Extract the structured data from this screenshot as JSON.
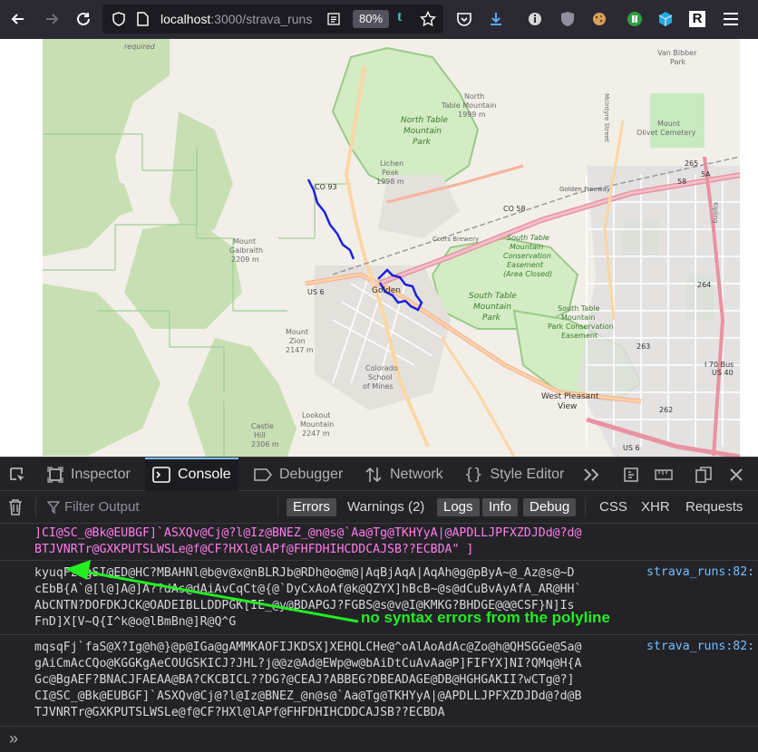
{
  "browser": {
    "url_host": "localhost",
    "url_path": ":3000/strava_runs",
    "zoom": "80%"
  },
  "map": {
    "labels": {
      "required": "required",
      "van_bibber": "Van Bibber",
      "park": "Park",
      "north_table_mountain": "North",
      "north_table_mountain2": "Table Mountain",
      "north_elev": "1999 m",
      "ntm_park1": "North Table",
      "ntm_park2": "Mountain",
      "ntm_park3": "Park",
      "mount_olivet1": "Mount",
      "mount_olivet2": "Olivet Cemetery",
      "lichen1": "Lichen",
      "lichen2": "Peak",
      "lichen3": "1998 m",
      "co93": "CO 93",
      "co58": "CO 58",
      "golden_fwy": "Golden Freeway",
      "coors": "Coors Brewery",
      "galbraith1": "Mount",
      "galbraith2": "Galbraith",
      "galbraith3": "2209 m",
      "stm1": "South Table",
      "stm2": "Mountain",
      "stm3": "Conservation",
      "stm4": "Easement",
      "stm5": "(Area Closed)",
      "stm_park1": "South Table",
      "stm_park2": "Mountain",
      "stm_park3": "Park",
      "stm_cons1": "South Table",
      "stm_cons2": "Mountain",
      "stm_cons3": "Park Conservation",
      "stm_cons4": "Easement",
      "golden": "Golden",
      "us6": "US 6",
      "us6b": "US 6",
      "zion1": "Mount",
      "zion2": "Zion",
      "zion3": "2147 m",
      "mines1": "Colorado",
      "mines2": "School",
      "mines3": "of Mines",
      "wpv1": "West Pleasant",
      "wpv2": "View",
      "lookout1": "Lookout",
      "lookout2": "Mountain",
      "lookout3": "2247 m",
      "castle1": "Castle",
      "castle2": "Hill",
      "castle3": "2306 m",
      "i70a": "I 70 Bus",
      "i70b": "US 40",
      "r265": "265",
      "r264": "264",
      "r263": "263",
      "r262": "262",
      "r58": "58",
      "r5a": "5A",
      "mcintyre": "McIntyre Street",
      "kipling": "Kipling"
    }
  },
  "devtools": {
    "tabs": {
      "inspector": "Inspector",
      "console": "Console",
      "debugger": "Debugger",
      "network": "Network",
      "style_editor": "Style Editor"
    },
    "filter_placeholder": "Filter Output",
    "filters": {
      "errors": "Errors",
      "warnings": "Warnings (2)",
      "logs": "Logs",
      "info": "Info",
      "debug": "Debug",
      "css": "CSS",
      "xhr": "XHR",
      "requests": "Requests"
    },
    "messages": [
      {
        "lines": [
          "]CI@SC_@Bk@EUBGF]`ASXQv@Cj@?l@Iz@BNEZ_@n@s@`Aa@Tg@TKHYyA|@APDLLJPFXZDJDd@?d@",
          "BTJVNRTr@GXKPUTSLWSLe@f@CF?HXl@lAPf@FHFDHIHCDDCAJSB??ECBDA\" ]"
        ],
        "source": ""
      },
      {
        "lines": [
          "kyuqFzsgSI@ED@HC?MBAHNl@b@v@x@nBLRJb@RDh@o@m@|AqBjAqA|AqAh@g@pByA~@_Az@s@~D",
          "cEbB{A`@[l@]A@]A??dAs@dAiAvCqCt@{@`DyCxAoAf@k@QZYX]hBcB~@s@dCuBvAyAfA_AR@HH`",
          "AbCNTN?DOFDKJCK@OADEIBLLDDPGK[IE_@y@BDAPGJ?FGBS@s@v@I@KMKG?BHDGE@@@CSF}N]Is",
          "FnD]X[V~Q{I^k@o@lBmBn@]R@Q^G"
        ],
        "source": "strava_runs:82:"
      },
      {
        "lines": [
          "mqsqFj`faS@X?Ig@h@}@p@IGa@gAMMKAOFIJKDSX]XEHQLCHe@^oAlAoAdAc@Zo@h@QHSGGe@Sa@",
          "gAiCmAcCQo@KGGKgAeCOUGSKICJ?JHL?j@@z@Ad@EWp@w@bAiDtCuAvAa@P]FIFYX]NI?QMq@H{A",
          "Gc@BgAEF?BNACJFAEAA@BA?CKCBICL??DG?@CEAJ?ABBEG?DBEADAGE@DB@HGHGAKII?wCTg@?]",
          "CI@SC_@Bk@EUBGF]`ASXQv@Cj@?l@Iz@BNEZ_@n@s@`Aa@Tg@TKHYyA|@APDLLJPFXZDJDd@?d@B",
          "TJVNRTr@GXKPUTSLWSLe@f@CF?HXl@lAPf@FHFDHIHCDDCAJSB??ECBDA"
        ],
        "source": "strava_runs:82:"
      }
    ],
    "prompt": "»"
  },
  "annotation": "no syntax errors from the polyline",
  "colors": {
    "accent": "#75bfff",
    "route": "#1a22e0",
    "annotation": "#22ee22",
    "log_pink": "#ff7de9"
  }
}
